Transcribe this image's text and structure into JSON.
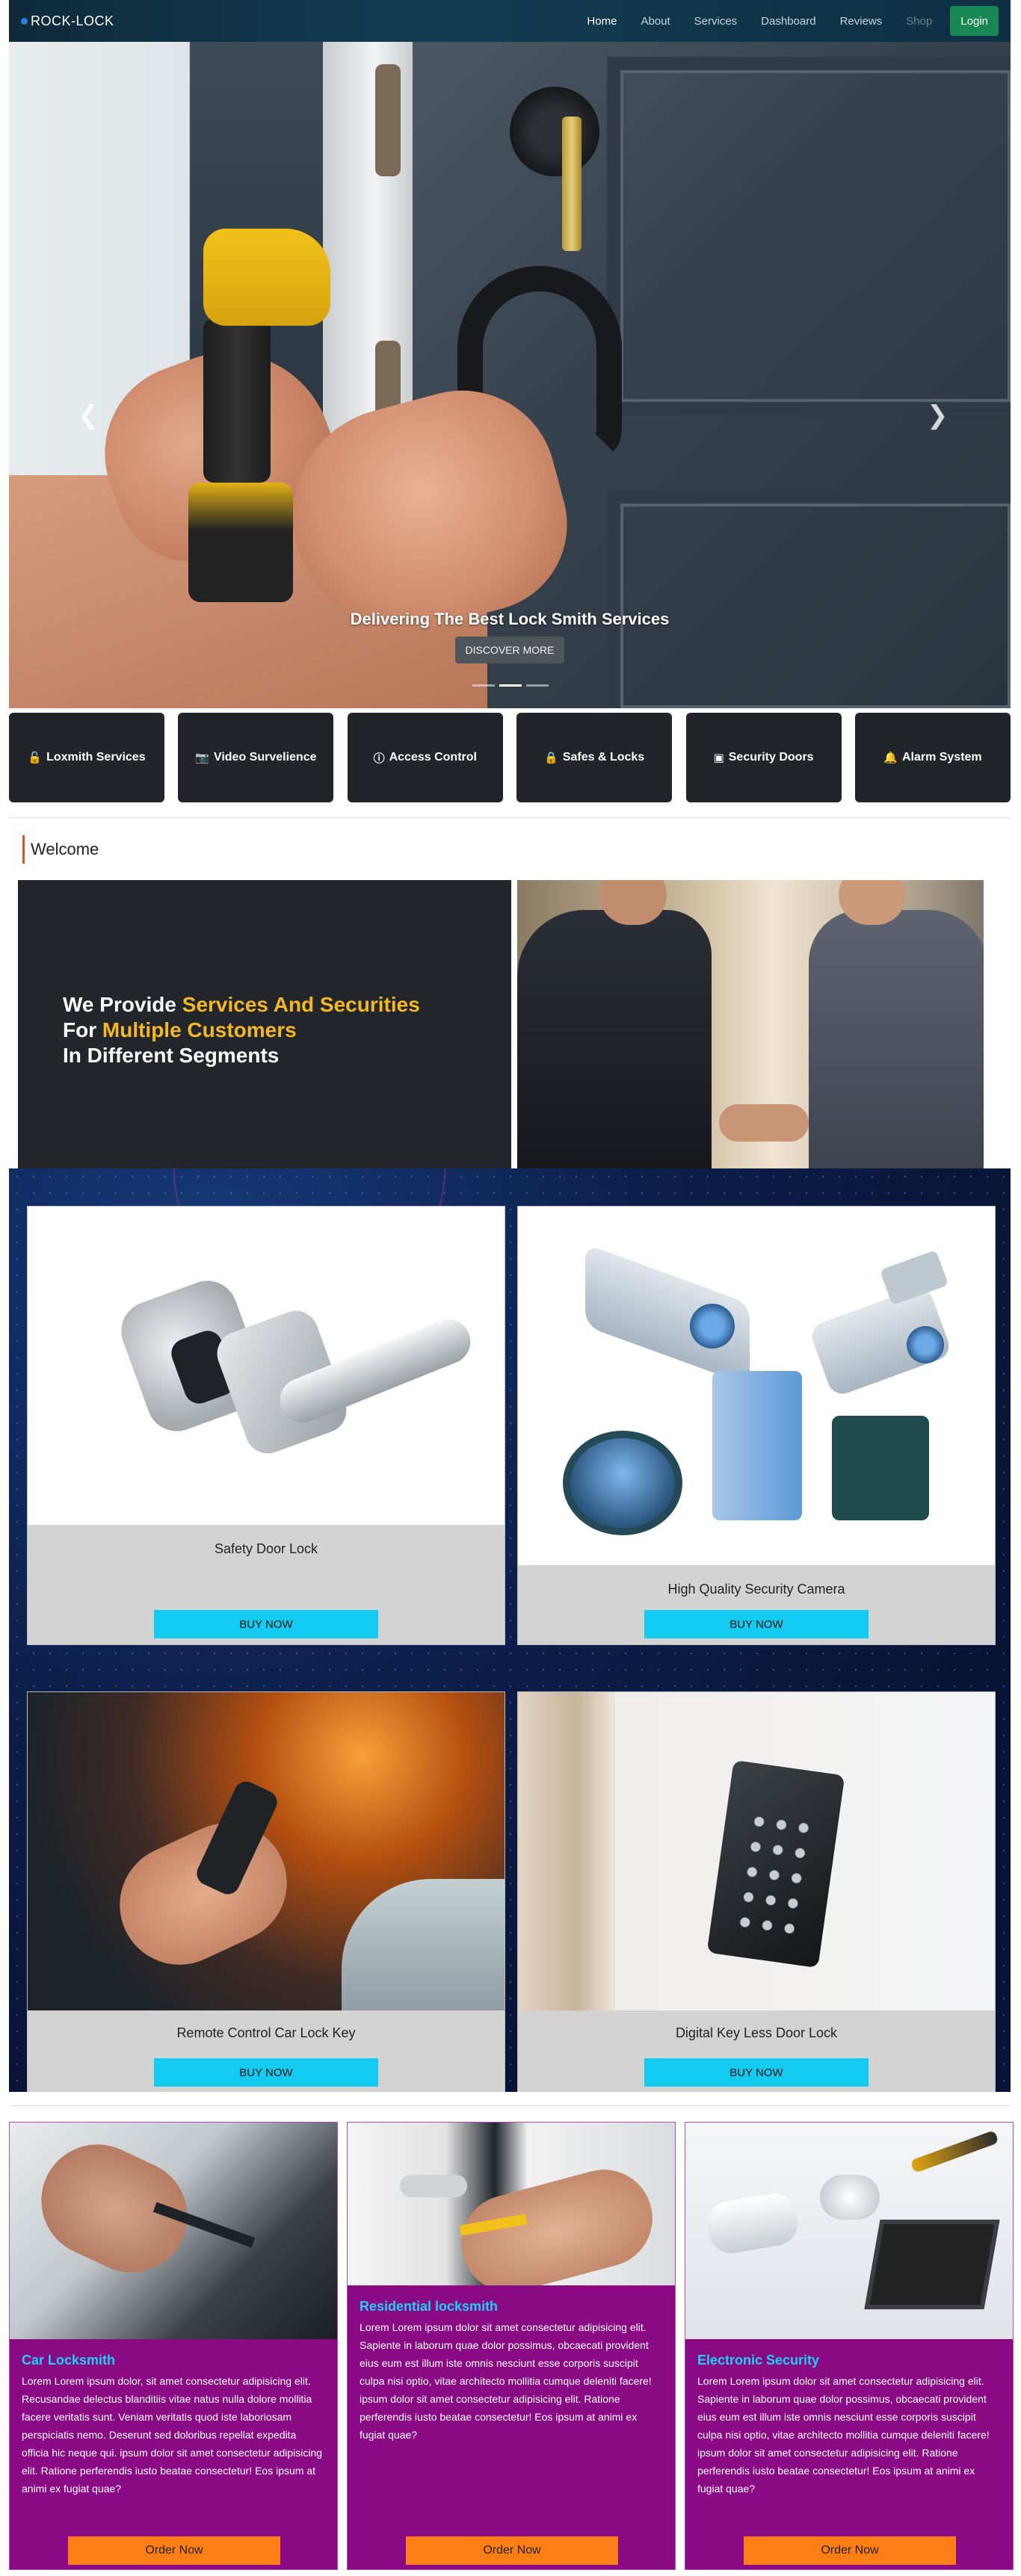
{
  "nav": {
    "brand": "ROCK-LOCK",
    "links": [
      {
        "label": "Home",
        "state": "active"
      },
      {
        "label": "About",
        "state": "normal"
      },
      {
        "label": "Services",
        "state": "normal"
      },
      {
        "label": "Dashboard",
        "state": "normal"
      },
      {
        "label": "Reviews",
        "state": "normal"
      },
      {
        "label": "Shop",
        "state": "disabled"
      }
    ],
    "login_label": "Login",
    "login_color": "#198754"
  },
  "hero": {
    "caption": "Delivering The Best Lock Smith Services",
    "button_label": "DISCOVER MORE",
    "prev_icon": "chevron-left-icon",
    "next_icon": "chevron-right-icon",
    "slides": 3,
    "active_slide": 2
  },
  "services_bar": [
    {
      "icon": "unlock-icon",
      "label": "Loxmith Services"
    },
    {
      "icon": "camera-icon",
      "label": "Video Survelience"
    },
    {
      "icon": "info-icon",
      "label": "Access Control"
    },
    {
      "icon": "safe-icon",
      "label": "Safes & Locks"
    },
    {
      "icon": "door-icon",
      "label": "Security Doors"
    },
    {
      "icon": "bell-icon",
      "label": "Alarm System"
    }
  ],
  "welcome": {
    "title": "Welcome",
    "line1_plain": "We Provide ",
    "line1_highlight": "Services And Securities",
    "line2_plain": "For ",
    "line2_highlight": "Multiple Customers",
    "line3": "In Different Segments",
    "highlight_color": "#f4b827"
  },
  "products": [
    {
      "title": "Safety Door Lock",
      "button": "BUY NOW"
    },
    {
      "title": "High Quality Security Camera",
      "button": "BUY NOW"
    },
    {
      "title": "Remote Control Car Lock Key",
      "button": "BUY NOW"
    },
    {
      "title": "Digital Key Less Door Lock",
      "button": "BUY NOW"
    }
  ],
  "service_cards": [
    {
      "title": "Car Locksmith",
      "body": "Lorem Lorem ipsum dolor, sit amet consectetur adipisicing elit. Recusandae delectus blanditiis vitae natus nulla dolore mollitia facere veritatis sunt. Veniam veritatis quod iste laboriosam perspiciatis nemo. Deserunt sed doloribus repellat expedita officia hic neque qui. ipsum dolor sit amet consectetur adipisicing elit. Ratione perferendis iusto beatae consectetur! Eos ipsum at animi ex fugiat quae?",
      "button": "Order Now"
    },
    {
      "title": "Residential locksmith",
      "body": "Lorem Lorem ipsum dolor sit amet consectetur adipisicing elit. Sapiente in laborum quae dolor possimus, obcaecati provident eius eum est illum iste omnis nesciunt esse corporis suscipit culpa nisi optio, vitae architecto mollitia cumque deleniti facere! ipsum dolor sit amet consectetur adipisicing elit. Ratione perferendis iusto beatae consectetur! Eos ipsum at animi ex fugiat quae?",
      "button": "Order Now"
    },
    {
      "title": "Electronic Security",
      "body": "Lorem Lorem ipsum dolor sit amet consectetur adipisicing elit. Sapiente in laborum quae dolor possimus, obcaecati provident eius eum est illum iste omnis nesciunt esse corporis suscipit culpa nisi optio, vitae architecto mollitia cumque deleniti facere! ipsum dolor sit amet consectetur adipisicing elit. Ratione perferendis iusto beatae consectetur! Eos ipsum at animi ex fugiat quae?",
      "button": "Order Now"
    }
  ],
  "colors": {
    "service_card_bg": "#8a0a85",
    "service_title": "#1ed0f5",
    "order_button": "#fd7e14",
    "buy_button": "#13caf0"
  }
}
